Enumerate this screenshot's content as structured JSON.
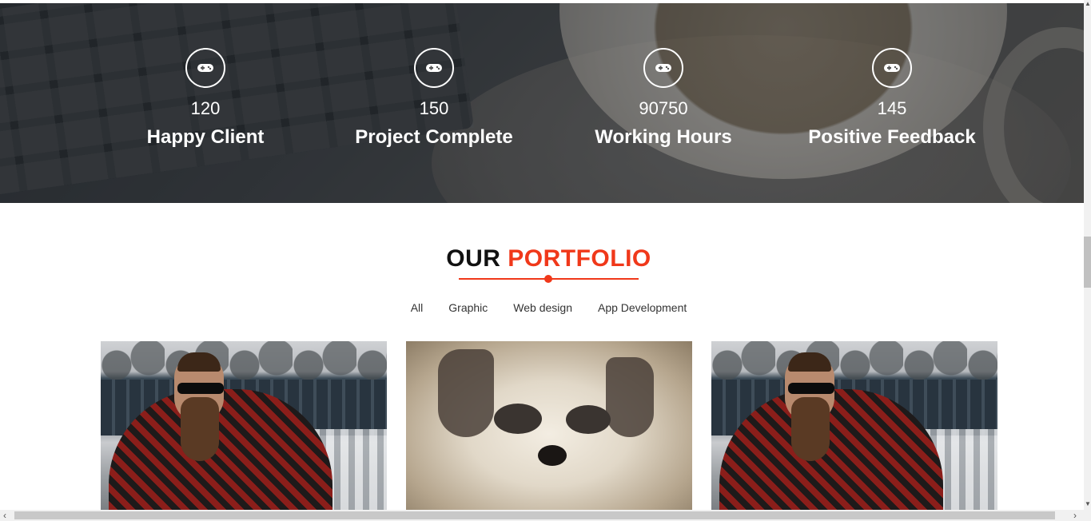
{
  "stats": [
    {
      "icon": "gamepad-icon",
      "value": "120",
      "label": "Happy Client"
    },
    {
      "icon": "gamepad-icon",
      "value": "150",
      "label": "Project Complete"
    },
    {
      "icon": "gamepad-icon",
      "value": "90750",
      "label": "Working Hours"
    },
    {
      "icon": "gamepad-icon",
      "value": "145",
      "label": "Positive Feedback"
    }
  ],
  "portfolio": {
    "title_part1": "OUR",
    "title_part2": "PORTFOLIO",
    "accent_color": "#f0381a",
    "filters": [
      "All",
      "Graphic",
      "Web design",
      "App Development"
    ],
    "items": [
      {
        "image": "bearded-man-photo"
      },
      {
        "image": "puppy-photo"
      },
      {
        "image": "bearded-man-photo"
      }
    ]
  },
  "scrollbars": {
    "left_arrow": "‹",
    "right_arrow": "›",
    "up_arrow": "▲",
    "down_arrow": "▼"
  }
}
